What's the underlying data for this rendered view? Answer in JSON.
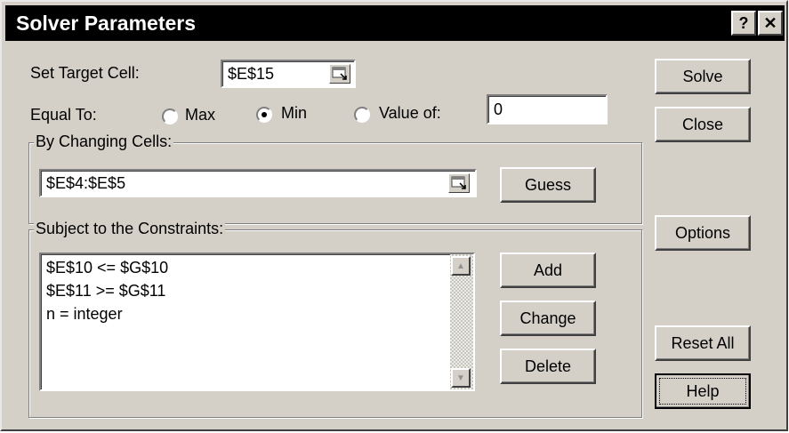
{
  "window": {
    "title": "Solver Parameters",
    "help_glyph": "?",
    "close_glyph": "✕"
  },
  "target": {
    "label": "Set Target Cell:",
    "value": "$E$15"
  },
  "equal_to": {
    "label": "Equal To:",
    "options": [
      {
        "label": "Max",
        "selected": false
      },
      {
        "label": "Min",
        "selected": true
      },
      {
        "label": "Value of:",
        "selected": false
      }
    ],
    "value_of": "0"
  },
  "changing": {
    "label": "By Changing Cells:",
    "value": "$E$4:$E$5",
    "guess_label": "Guess"
  },
  "constraints": {
    "label": "Subject to the Constraints:",
    "items": [
      "$E$10 <= $G$10",
      "$E$11 >= $G$11",
      "n = integer"
    ],
    "add_label": "Add",
    "change_label": "Change",
    "delete_label": "Delete"
  },
  "buttons": {
    "solve": "Solve",
    "close": "Close",
    "options": "Options",
    "reset_all": "Reset All",
    "help": "Help"
  }
}
